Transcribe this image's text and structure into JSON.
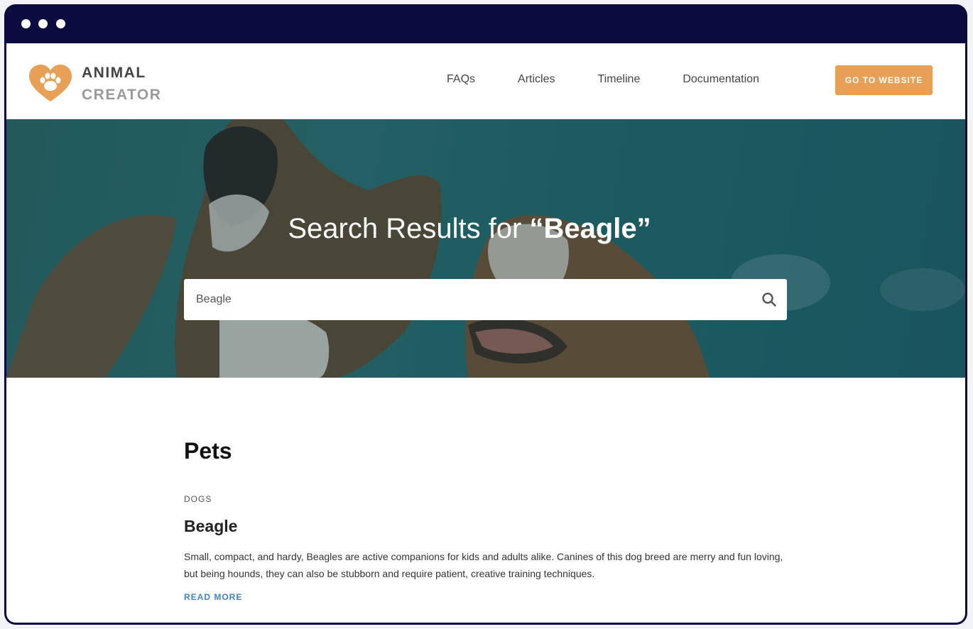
{
  "window": {
    "controls": [
      "dot-1",
      "dot-2",
      "dot-3"
    ]
  },
  "header": {
    "logo": {
      "line1": "ANIMAL",
      "line2": "CREATOR",
      "icon": "heart-paw-icon",
      "color": "#e8a056"
    },
    "nav": [
      {
        "label": "FAQs"
      },
      {
        "label": "Articles"
      },
      {
        "label": "Timeline"
      },
      {
        "label": "Documentation"
      }
    ],
    "cta_label": "GO TO WEBSITE",
    "cta_color": "#e8a056"
  },
  "hero": {
    "title_prefix": "Search Results for ",
    "title_query": "“Beagle”",
    "search_value": "Beagle",
    "search_icon": "search-icon"
  },
  "results": {
    "section_title": "Pets",
    "items": [
      {
        "category": "DOGS",
        "title": "Beagle",
        "excerpt": "Small, compact, and hardy, Beagles are active companions for kids and adults alike. Canines of this dog breed are merry and fun loving, but being hounds, they can also be stubborn and require patient, creative training techniques.",
        "read_more": "READ MORE",
        "link_color": "#3f83c6"
      }
    ]
  }
}
